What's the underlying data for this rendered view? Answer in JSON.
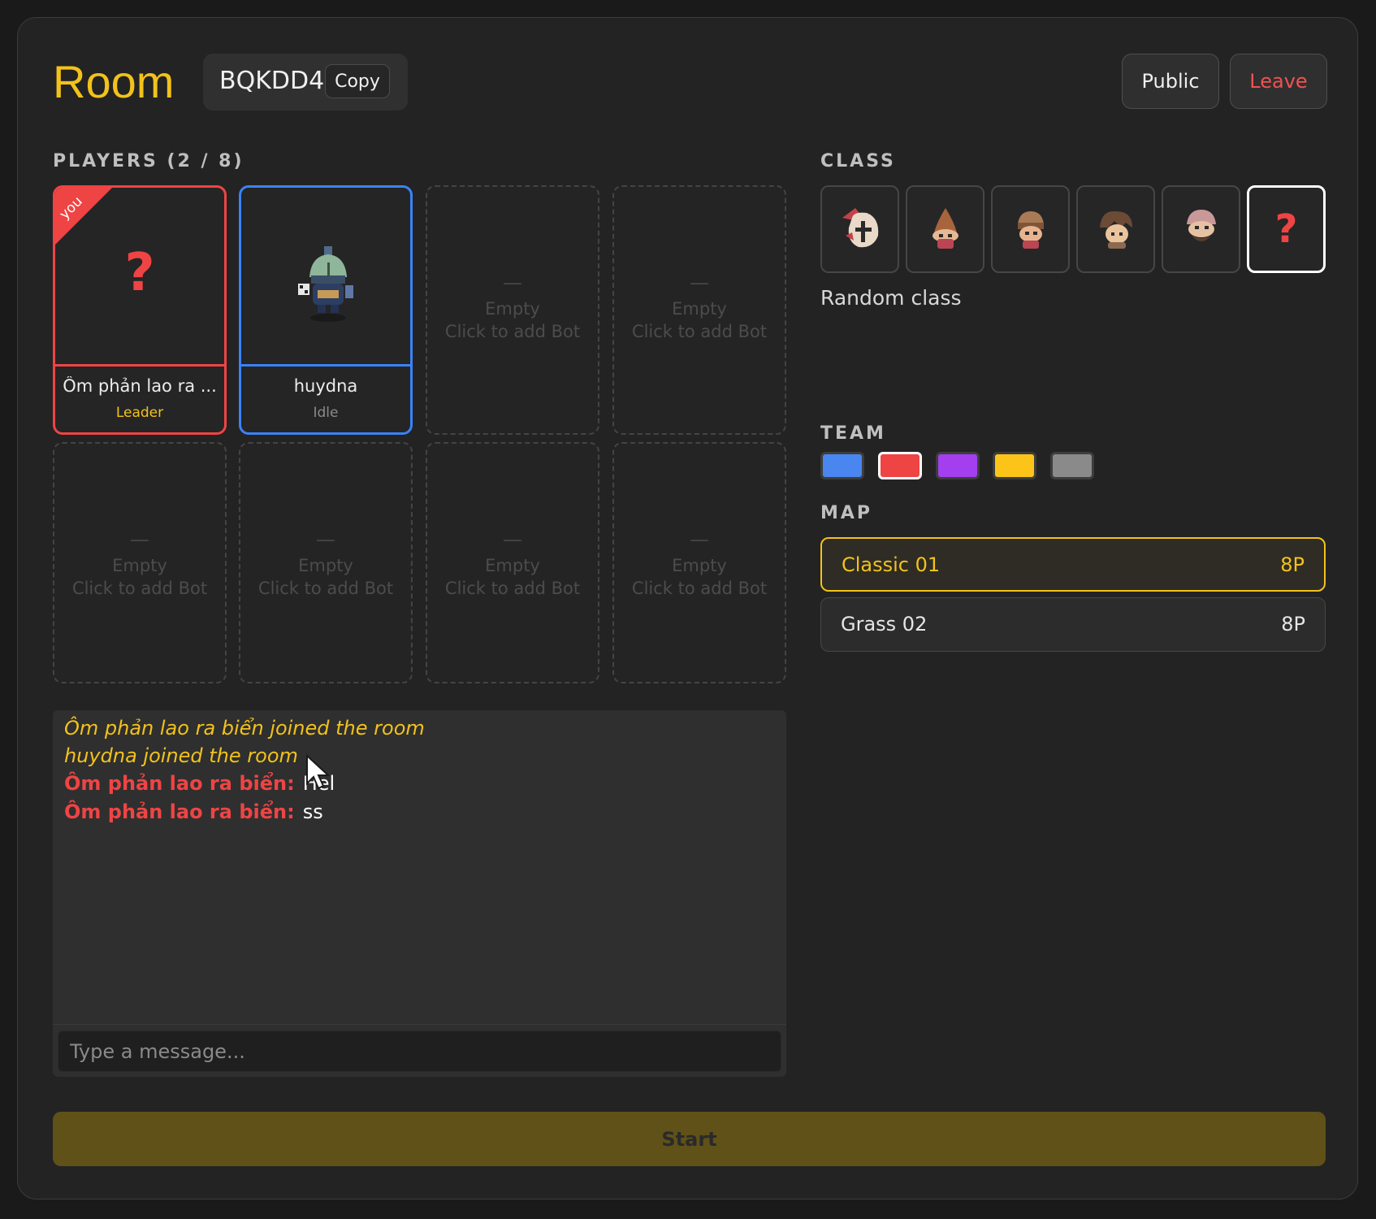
{
  "header": {
    "title": "Room",
    "room_code": "BQKDD4",
    "copy_label": "Copy",
    "public_label": "Public",
    "leave_label": "Leave"
  },
  "players": {
    "label": "PLAYERS (2 / 8)",
    "slots": [
      {
        "name": "Ôm phản lao ra ...",
        "role": "Leader",
        "badge": "you",
        "avatar": "?"
      },
      {
        "name": "huydna",
        "role": "Idle",
        "avatar": "knight-sprite"
      },
      {
        "dash": "—",
        "line1": "Empty",
        "line2": "Click to add Bot"
      },
      {
        "dash": "—",
        "line1": "Empty",
        "line2": "Click to add Bot"
      },
      {
        "dash": "—",
        "line1": "Empty",
        "line2": "Click to add Bot"
      },
      {
        "dash": "—",
        "line1": "Empty",
        "line2": "Click to add Bot"
      },
      {
        "dash": "—",
        "line1": "Empty",
        "line2": "Click to add Bot"
      },
      {
        "dash": "—",
        "line1": "Empty",
        "line2": "Click to add Bot"
      }
    ]
  },
  "chat": {
    "lines": [
      {
        "type": "system",
        "text": "Ôm phản lao ra biển joined the room"
      },
      {
        "type": "system",
        "text": "huydna joined the room"
      },
      {
        "type": "message",
        "author": "Ôm phản lao ra biển:",
        "text": "Hel"
      },
      {
        "type": "message",
        "author": "Ôm phản lao ra biển:",
        "text": "ss"
      }
    ],
    "placeholder": "Type a message..."
  },
  "class": {
    "label": "CLASS",
    "options": [
      "crusader-sprite",
      "hooded-sprite",
      "warrior-sprite",
      "brute-sprite",
      "bearded-sprite",
      "random"
    ],
    "random_glyph": "?",
    "selected_caption": "Random class"
  },
  "team": {
    "label": "TEAM",
    "colors": [
      "#4a86f0",
      "#ef4444",
      "#a43ff0",
      "#fcc419",
      "#8a8a8a"
    ],
    "selected": 1
  },
  "map": {
    "label": "MAP",
    "items": [
      {
        "name": "Classic 01",
        "size": "8P",
        "selected": true
      },
      {
        "name": "Grass 02",
        "size": "8P",
        "selected": false
      }
    ]
  },
  "start_label": "Start",
  "colors": {
    "accent": "#f2c21b",
    "danger": "#ef4444",
    "player_blue": "#3b82f6",
    "start_bg": "#5f5118"
  }
}
